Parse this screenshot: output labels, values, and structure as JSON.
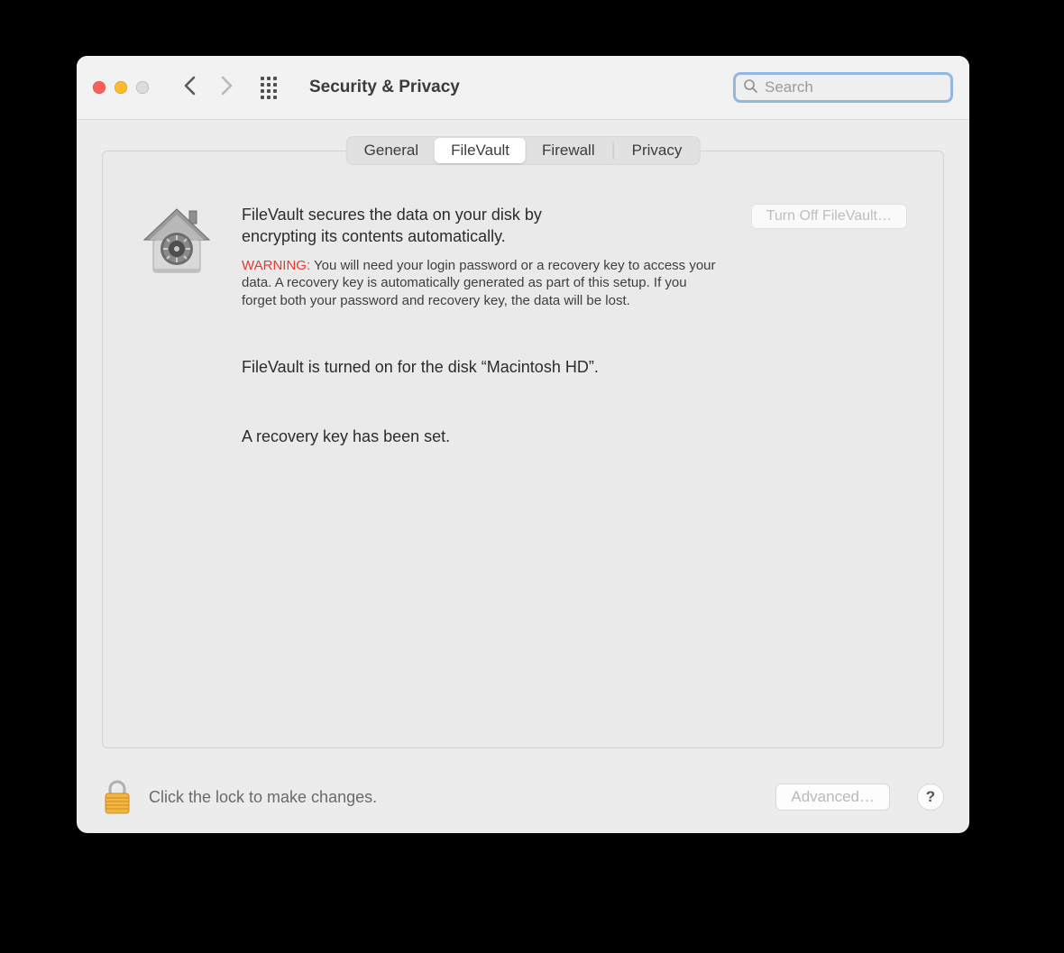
{
  "window": {
    "title": "Security & Privacy"
  },
  "search": {
    "placeholder": "Search"
  },
  "tabs": {
    "general": "General",
    "filevault": "FileVault",
    "firewall": "Firewall",
    "privacy": "Privacy"
  },
  "filevault": {
    "description": "FileVault secures the data on your disk by encrypting its contents automatically.",
    "warning_label": "WARNING:",
    "warning_text": "You will need your login password or a recovery key to access your data. A recovery key is automatically generated as part of this setup. If you forget both your password and recovery key, the data will be lost.",
    "turn_off_label": "Turn Off FileVault…",
    "status_on": "FileVault is turned on for the disk “Macintosh HD”.",
    "recovery_set": "A recovery key has been set."
  },
  "footer": {
    "lock_text": "Click the lock to make changes.",
    "advanced_label": "Advanced…",
    "help_label": "?"
  }
}
